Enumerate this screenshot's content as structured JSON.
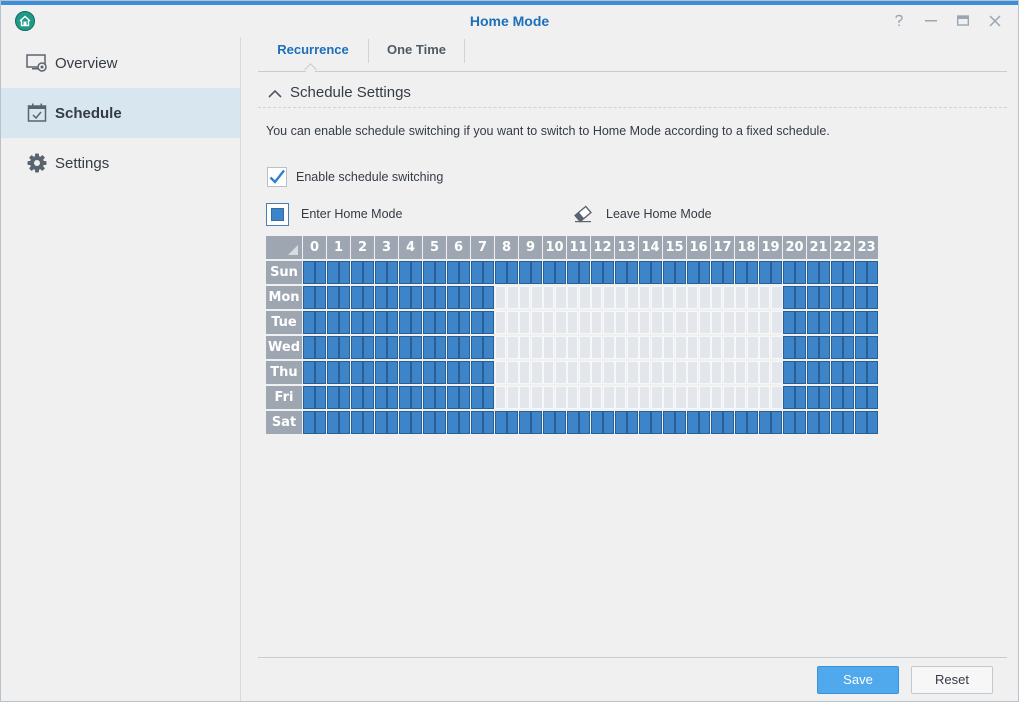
{
  "window": {
    "title": "Home Mode",
    "controls": [
      "help-icon",
      "minimize-icon",
      "maximize-icon",
      "close-icon"
    ]
  },
  "sidebar": {
    "items": [
      {
        "label": "Overview",
        "icon": "overview-icon",
        "active": false
      },
      {
        "label": "Schedule",
        "icon": "calendar-icon",
        "active": true
      },
      {
        "label": "Settings",
        "icon": "gear-icon",
        "active": false
      }
    ]
  },
  "tabs": [
    {
      "label": "Recurrence",
      "active": true
    },
    {
      "label": "One Time",
      "active": false
    }
  ],
  "section": {
    "title": "Schedule Settings",
    "description": "You can enable schedule switching if you want to switch to Home Mode according to a fixed schedule.",
    "enable_label": "Enable schedule switching",
    "enable_checked": true
  },
  "legend": {
    "enter_label": "Enter Home Mode",
    "leave_label": "Leave Home Mode"
  },
  "schedule": {
    "hours": [
      "0",
      "1",
      "2",
      "3",
      "4",
      "5",
      "6",
      "7",
      "8",
      "9",
      "10",
      "11",
      "12",
      "13",
      "14",
      "15",
      "16",
      "17",
      "18",
      "19",
      "20",
      "21",
      "22",
      "23"
    ],
    "days": [
      "Sun",
      "Mon",
      "Tue",
      "Wed",
      "Thu",
      "Fri",
      "Sat"
    ],
    "home_mode": [
      [
        1,
        1,
        1,
        1,
        1,
        1,
        1,
        1,
        1,
        1,
        1,
        1,
        1,
        1,
        1,
        1,
        1,
        1,
        1,
        1,
        1,
        1,
        1,
        1
      ],
      [
        1,
        1,
        1,
        1,
        1,
        1,
        1,
        1,
        0,
        0,
        0,
        0,
        0,
        0,
        0,
        0,
        0,
        0,
        0,
        0,
        1,
        1,
        1,
        1
      ],
      [
        1,
        1,
        1,
        1,
        1,
        1,
        1,
        1,
        0,
        0,
        0,
        0,
        0,
        0,
        0,
        0,
        0,
        0,
        0,
        0,
        1,
        1,
        1,
        1
      ],
      [
        1,
        1,
        1,
        1,
        1,
        1,
        1,
        1,
        0,
        0,
        0,
        0,
        0,
        0,
        0,
        0,
        0,
        0,
        0,
        0,
        1,
        1,
        1,
        1
      ],
      [
        1,
        1,
        1,
        1,
        1,
        1,
        1,
        1,
        0,
        0,
        0,
        0,
        0,
        0,
        0,
        0,
        0,
        0,
        0,
        0,
        1,
        1,
        1,
        1
      ],
      [
        1,
        1,
        1,
        1,
        1,
        1,
        1,
        1,
        0,
        0,
        0,
        0,
        0,
        0,
        0,
        0,
        0,
        0,
        0,
        0,
        1,
        1,
        1,
        1
      ],
      [
        1,
        1,
        1,
        1,
        1,
        1,
        1,
        1,
        1,
        1,
        1,
        1,
        1,
        1,
        1,
        1,
        1,
        1,
        1,
        1,
        1,
        1,
        1,
        1
      ]
    ],
    "colors": {
      "enter": "#3d85c8",
      "leave": "#e3e6ea"
    }
  },
  "footer": {
    "save_label": "Save",
    "reset_label": "Reset"
  }
}
